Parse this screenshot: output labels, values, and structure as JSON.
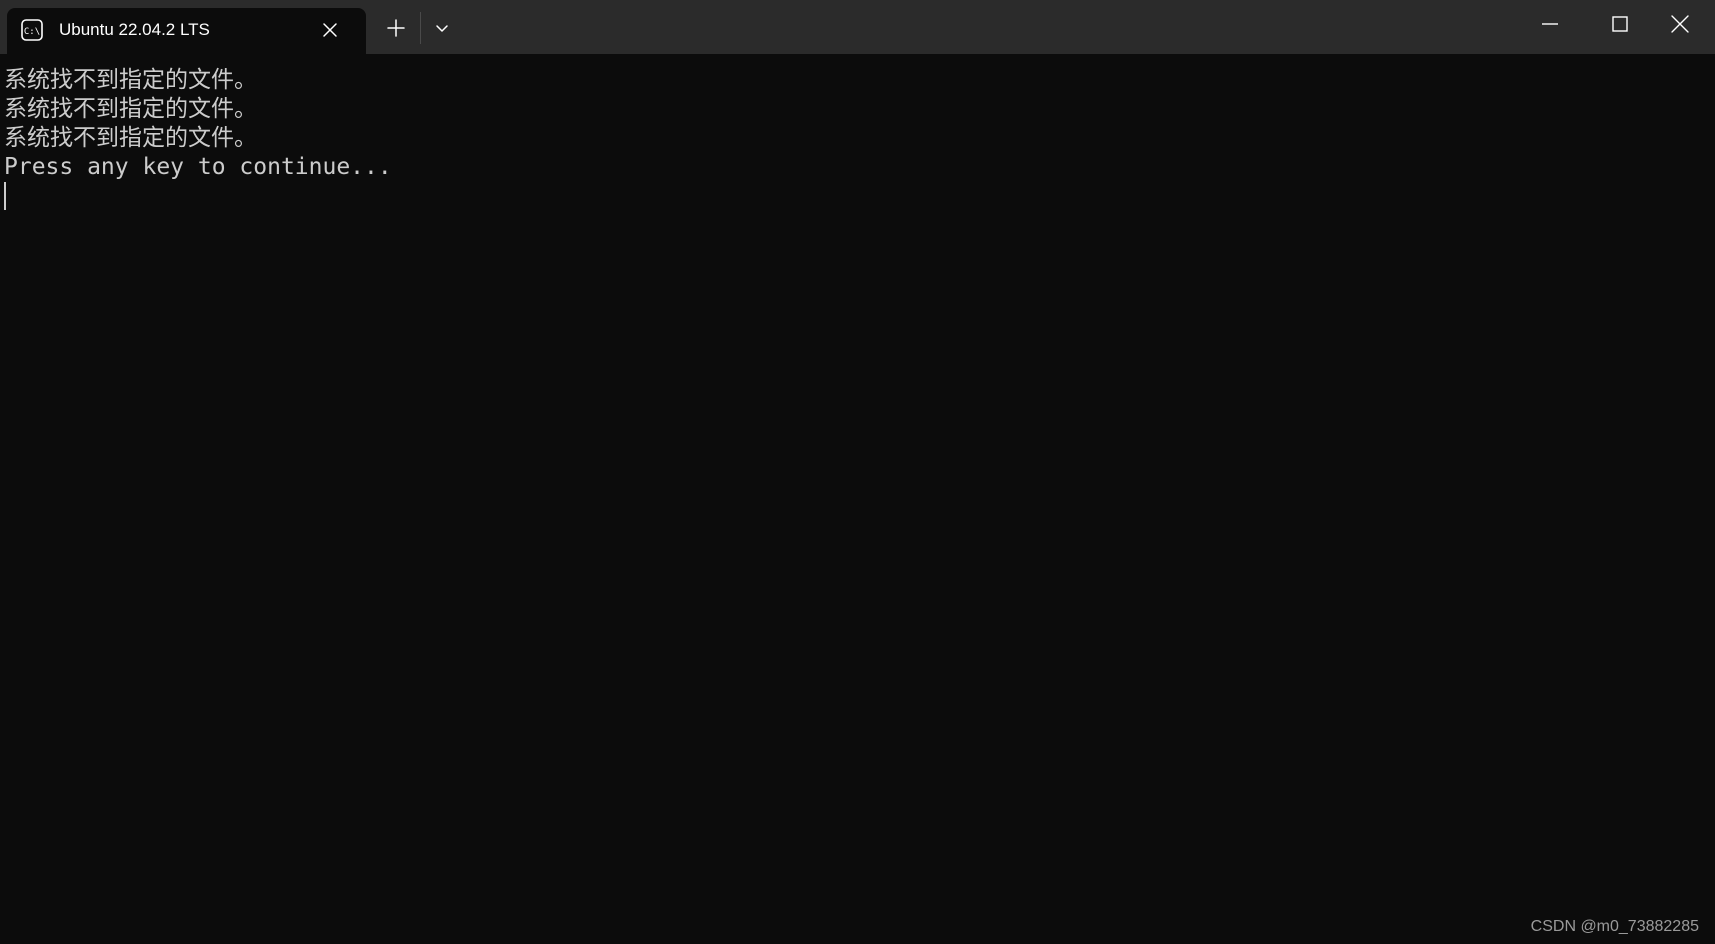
{
  "tab": {
    "title": "Ubuntu 22.04.2 LTS",
    "icon": "terminal-icon"
  },
  "tab_controls": {
    "new_tab_icon": "plus-icon",
    "dropdown_icon": "chevron-down-icon"
  },
  "window_controls": {
    "minimize_icon": "minimize-icon",
    "maximize_icon": "maximize-icon",
    "close_icon": "close-icon"
  },
  "terminal": {
    "lines": [
      "系统找不到指定的文件。",
      "系统找不到指定的文件。",
      "系统找不到指定的文件。",
      "Press any key to continue..."
    ]
  },
  "watermark": "CSDN @m0_73882285",
  "colors": {
    "terminal_bg": "#0c0c0c",
    "titlebar_bg": "#2b2b2b",
    "text": "#cccccc"
  }
}
